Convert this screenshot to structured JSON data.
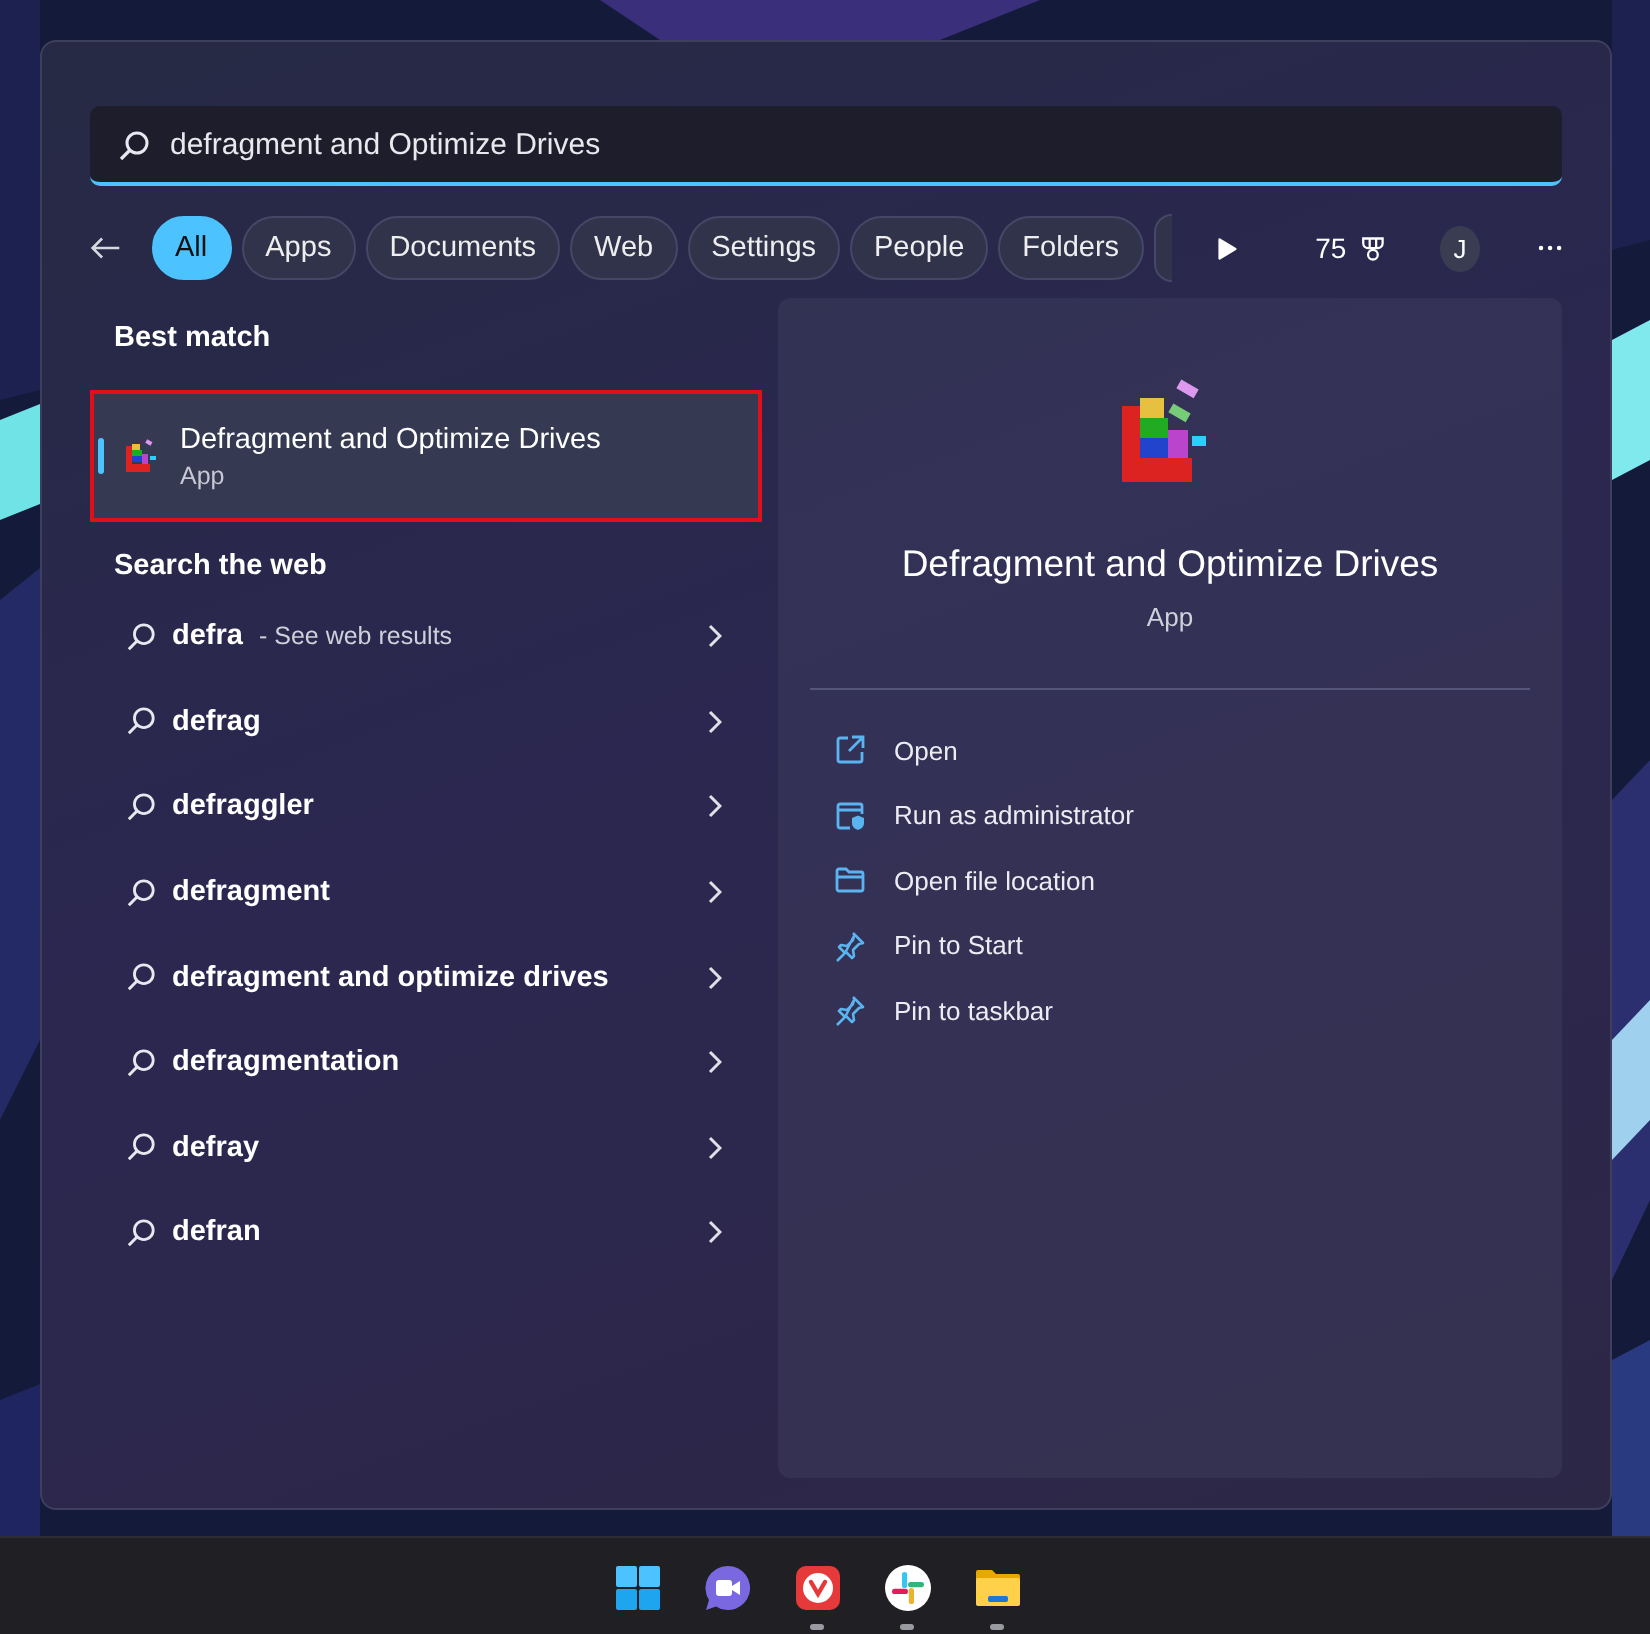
{
  "search": {
    "value": "defragment and Optimize Drives"
  },
  "filters": [
    {
      "label": "All",
      "selected": true
    },
    {
      "label": "Apps",
      "selected": false
    },
    {
      "label": "Documents",
      "selected": false
    },
    {
      "label": "Web",
      "selected": false
    },
    {
      "label": "Settings",
      "selected": false
    },
    {
      "label": "People",
      "selected": false
    },
    {
      "label": "Folders",
      "selected": false
    }
  ],
  "rewards": {
    "points": "75"
  },
  "account": {
    "initial": "J"
  },
  "best_match": {
    "heading": "Best match",
    "item": {
      "title": "Defragment and Optimize Drives",
      "subtitle": "App",
      "selected": true
    }
  },
  "web": {
    "heading": "Search the web",
    "items": [
      {
        "query": "defra",
        "hint": "- See web results"
      },
      {
        "query": "defrag"
      },
      {
        "query": "defraggler"
      },
      {
        "query": "defragment"
      },
      {
        "query": "defragment and optimize drives"
      },
      {
        "query": "defragmentation"
      },
      {
        "query": "defray"
      },
      {
        "query": "defran"
      }
    ]
  },
  "detail": {
    "title": "Defragment and Optimize Drives",
    "subtitle": "App",
    "actions": [
      {
        "kind": "open",
        "label": "Open"
      },
      {
        "kind": "admin",
        "label": "Run as administrator"
      },
      {
        "kind": "folder",
        "label": "Open file location"
      },
      {
        "kind": "pin",
        "label": "Pin to Start"
      },
      {
        "kind": "pin",
        "label": "Pin to taskbar"
      }
    ]
  },
  "taskbar": {
    "apps": [
      {
        "kind": "start",
        "running": false
      },
      {
        "kind": "meet",
        "running": false
      },
      {
        "kind": "browser",
        "running": true
      },
      {
        "kind": "chat",
        "running": true
      },
      {
        "kind": "folder",
        "running": true
      }
    ]
  }
}
